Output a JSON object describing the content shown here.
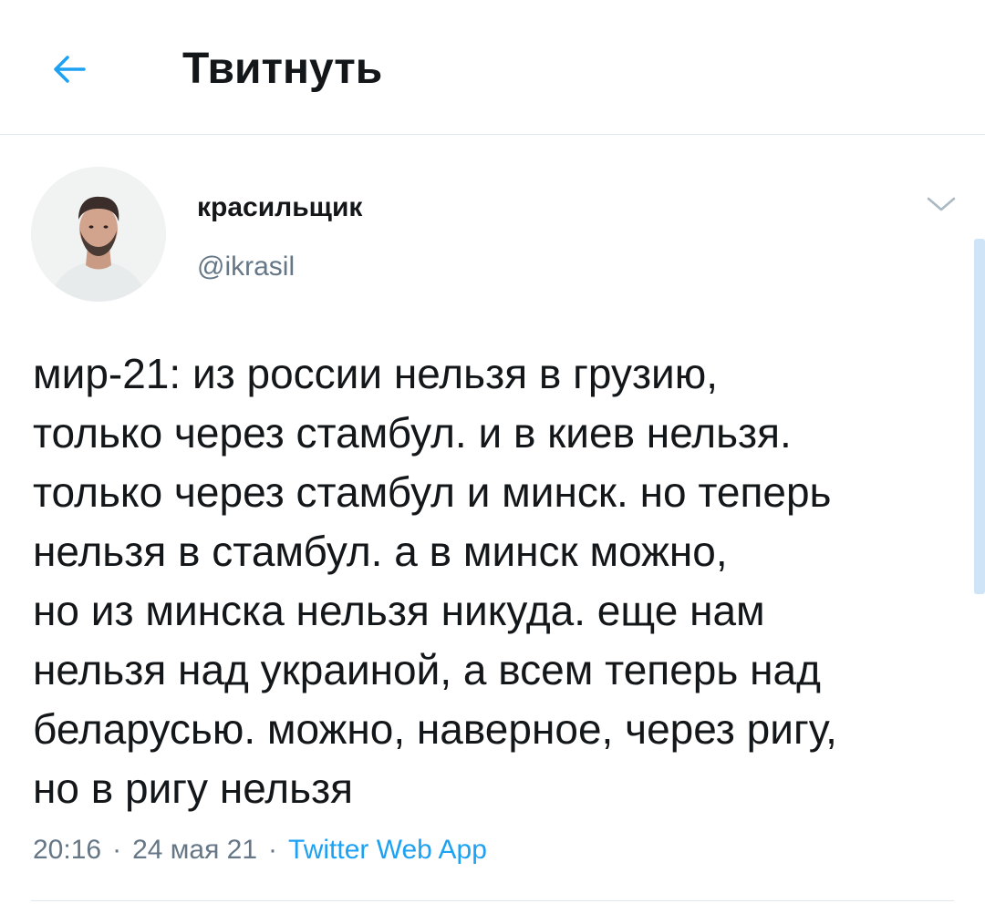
{
  "header": {
    "title": "Твитнуть",
    "back_icon": "arrow-left-icon"
  },
  "colors": {
    "accent": "#1da1f2",
    "text_primary": "#14171a",
    "text_secondary": "#657786",
    "divider": "#e1e8ed"
  },
  "tweet": {
    "author": {
      "name": "красильщик",
      "handle": "@ikrasil"
    },
    "caret_icon": "chevron-down-icon",
    "text_lines": [
      "мир-21: из россии нельзя в грузию,",
      "только через стамбул. и в киев нельзя.",
      "только через стамбул и минск. но теперь",
      "нельзя в стамбул. а в минск можно,",
      "но из минска нельзя никуда. еще нам",
      "нельзя над украиной, а всем теперь над",
      "беларусью. можно, наверное, через ригу,",
      "но в ригу нельзя"
    ],
    "meta": {
      "time": "20:16",
      "separator": "·",
      "date": "24 мая 21",
      "source": "Twitter Web App"
    }
  }
}
